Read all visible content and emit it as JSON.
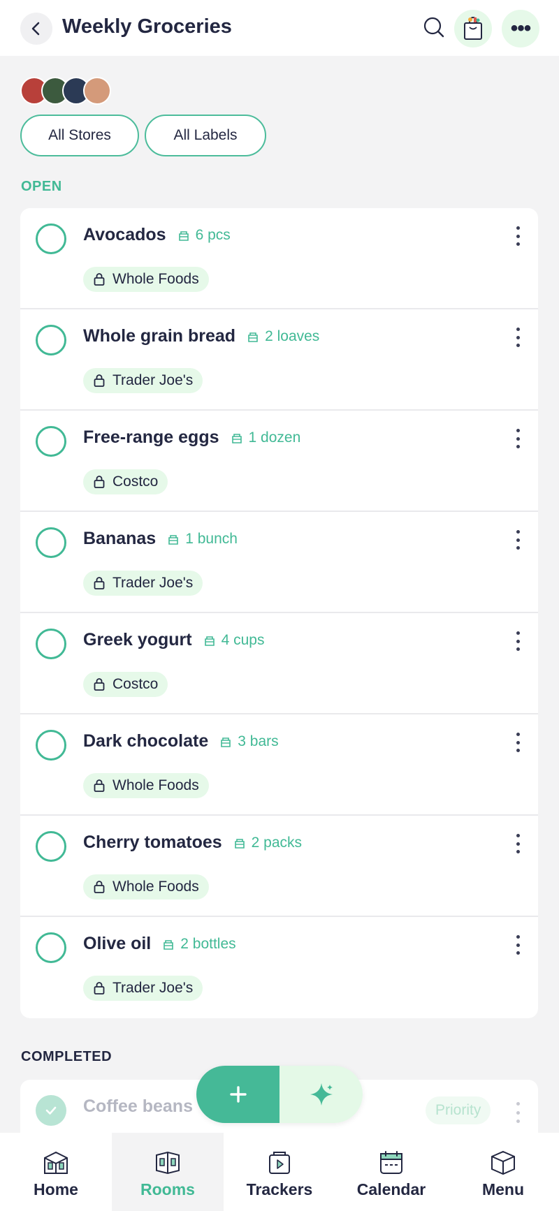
{
  "header": {
    "title": "Weekly Groceries",
    "back_icon": "chevron-left-icon",
    "search_icon": "search-icon",
    "bag_icon": "shopping-bag-icon",
    "more_icon": "more-horizontal-icon",
    "more_glyph": "•••"
  },
  "avatars": [
    {
      "name": "avatar-1",
      "color": "#b8403a"
    },
    {
      "name": "avatar-2",
      "color": "#3c5a3e"
    },
    {
      "name": "avatar-3",
      "color": "#2b3a55"
    },
    {
      "name": "avatar-4",
      "color": "#d49a7a"
    }
  ],
  "filters": {
    "stores": "All Stores",
    "labels": "All Labels"
  },
  "sections": {
    "open": "OPEN",
    "completed": "COMPLETED"
  },
  "items": [
    {
      "name": "Avocados",
      "qty": "6 pcs",
      "store": "Whole Foods"
    },
    {
      "name": "Whole grain bread",
      "qty": "2 loaves",
      "store": "Trader Joe's"
    },
    {
      "name": "Free-range eggs",
      "qty": "1 dozen",
      "store": "Costco"
    },
    {
      "name": "Bananas",
      "qty": "1 bunch",
      "store": "Trader Joe's"
    },
    {
      "name": "Greek yogurt",
      "qty": "4 cups",
      "store": "Costco"
    },
    {
      "name": "Dark chocolate",
      "qty": "3 bars",
      "store": "Whole Foods"
    },
    {
      "name": "Cherry tomatoes",
      "qty": "2 packs",
      "store": "Whole Foods"
    },
    {
      "name": "Olive oil",
      "qty": "2 bottles",
      "store": "Trader Joe's"
    }
  ],
  "completed": [
    {
      "name": "Coffee beans",
      "badge": "Priority"
    }
  ],
  "fab": {
    "add_icon": "plus-icon",
    "ai_icon": "sparkle-icon"
  },
  "nav": {
    "home": "Home",
    "rooms": "Rooms",
    "trackers": "Trackers",
    "calendar": "Calendar",
    "menu": "Menu",
    "active": "Rooms"
  },
  "colors": {
    "accent": "#41b995",
    "chip_bg": "#e6f9e9",
    "text": "#232741"
  }
}
